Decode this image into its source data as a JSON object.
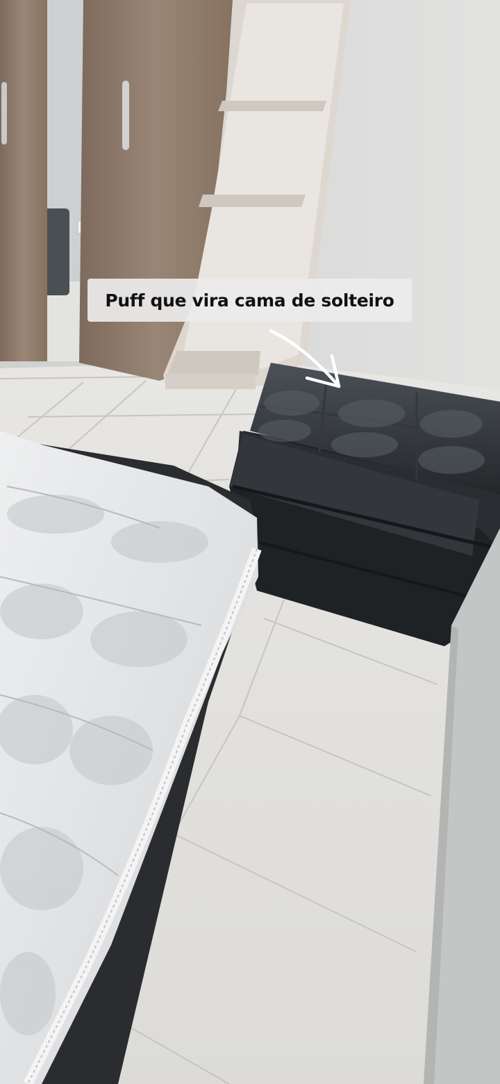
{
  "story": {
    "caption": "Puff que vira cama de solteiro"
  },
  "colors": {
    "wall": "#dcdcdc",
    "floor": "#e6e6e3",
    "wardrobe_wood": "#8a7666",
    "shelf": "#dcd6cf",
    "puff": "#2e3236",
    "mattress": "#e4e5e6"
  },
  "icons": [
    "arrow-icon"
  ]
}
